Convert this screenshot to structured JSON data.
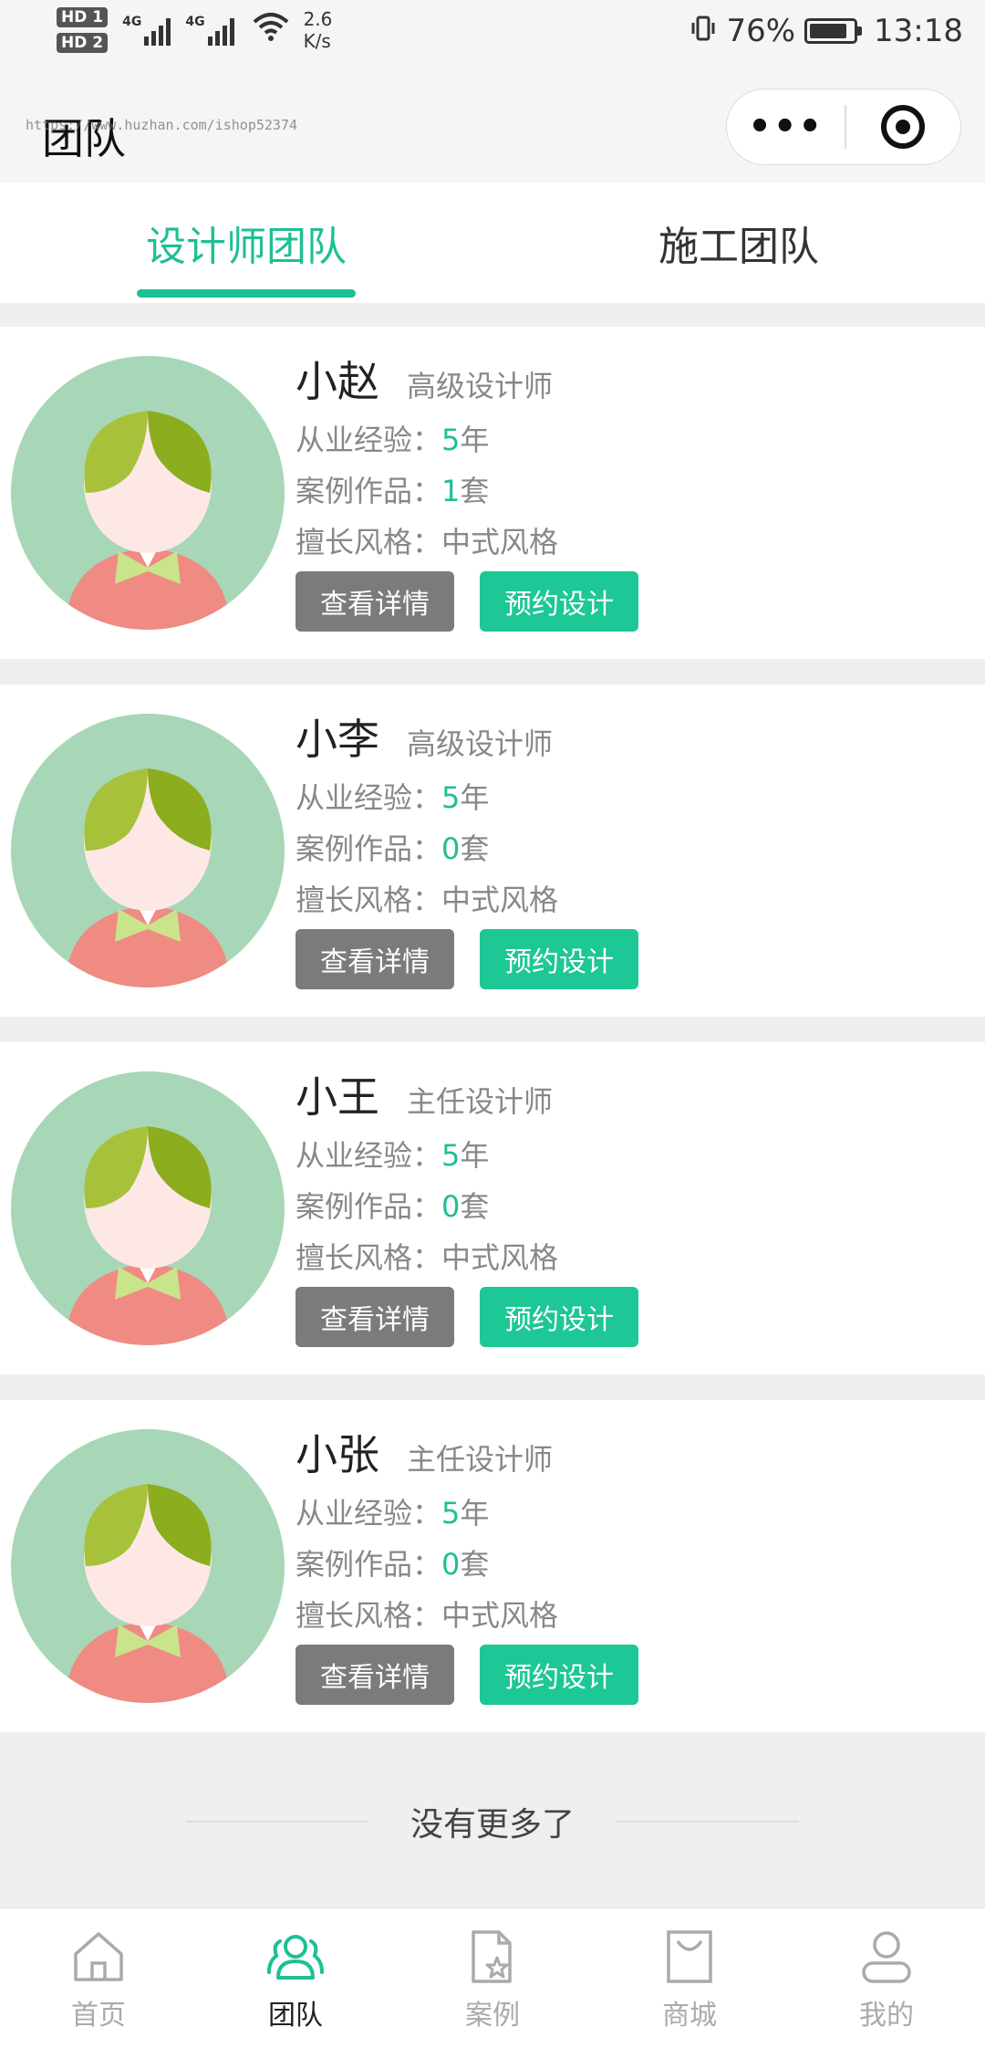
{
  "status_bar": {
    "hd1": "HD 1",
    "hd2": "HD 2",
    "sig1": "4G",
    "sig2": "4G",
    "speed_top": "2.6",
    "speed_bottom": "K/s",
    "battery": "76%",
    "time": "13:18"
  },
  "nav": {
    "title": "团队",
    "watermark": "https://www.huzhan.com/ishop52374",
    "more": "•••"
  },
  "tabs": [
    {
      "label": "设计师团队",
      "active": true
    },
    {
      "label": "施工团队",
      "active": false
    }
  ],
  "labels": {
    "experience": "从业经验：",
    "cases": "案例作品：",
    "style": "擅长风格：",
    "view_details": "查看详情",
    "book_design": "预约设计",
    "year_unit": "年",
    "set_unit": "套"
  },
  "designers": [
    {
      "name": "小赵",
      "title": "高级设计师",
      "experience": "5",
      "cases": "1",
      "style": "中式风格"
    },
    {
      "name": "小李",
      "title": "高级设计师",
      "experience": "5",
      "cases": "0",
      "style": "中式风格"
    },
    {
      "name": "小王",
      "title": "主任设计师",
      "experience": "5",
      "cases": "0",
      "style": "中式风格"
    },
    {
      "name": "小张",
      "title": "主任设计师",
      "experience": "5",
      "cases": "0",
      "style": "中式风格"
    }
  ],
  "no_more": "没有更多了",
  "tabbar": [
    {
      "label": "首页",
      "icon": "home-icon",
      "active": false
    },
    {
      "label": "团队",
      "icon": "team-icon",
      "active": true
    },
    {
      "label": "案例",
      "icon": "case-icon",
      "active": false
    },
    {
      "label": "商城",
      "icon": "shop-icon",
      "active": false
    },
    {
      "label": "我的",
      "icon": "user-icon",
      "active": false
    }
  ],
  "colors": {
    "accent": "#1fbf95",
    "button_green": "#1dc796",
    "button_gray": "#7b7b7b"
  }
}
